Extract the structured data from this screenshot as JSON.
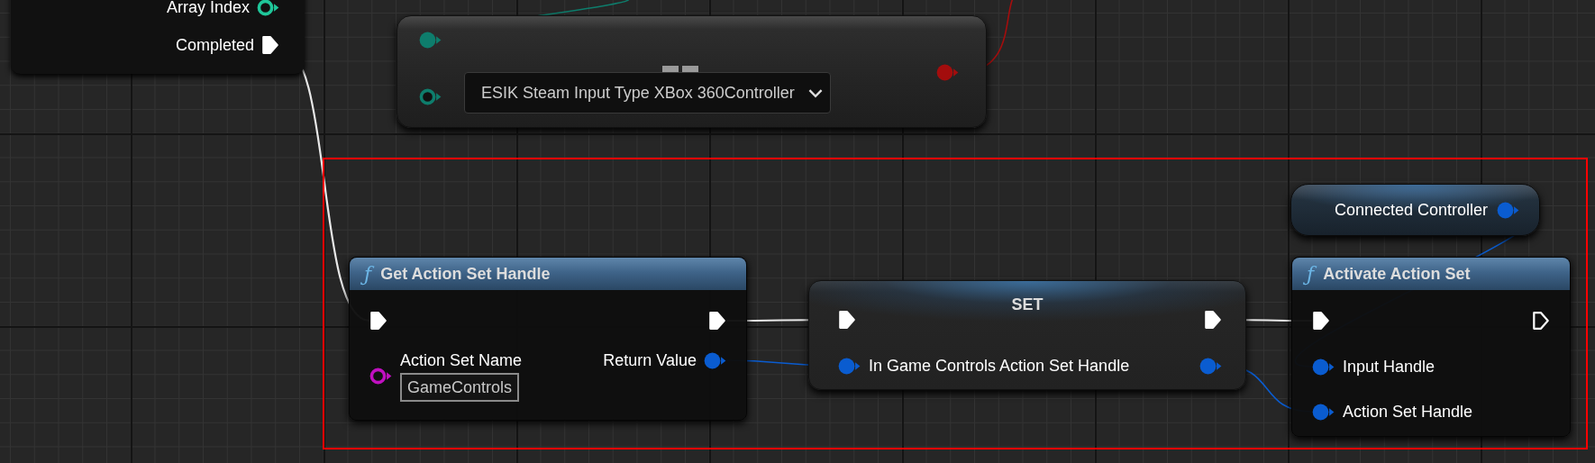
{
  "graph": {
    "highlight": {
      "color": "#ff0000"
    },
    "nodes": [
      {
        "kind": "loop",
        "outputs": [
          {
            "label": "Array Index",
            "pin": {
              "kind": "data",
              "color": "#1fc79a",
              "connected": false
            }
          },
          {
            "label": "Completed",
            "pin": {
              "kind": "exec",
              "connected": true
            }
          }
        ]
      },
      {
        "kind": "compare",
        "inputs": [
          {
            "pin": {
              "kind": "data",
              "color": "#0e7d6c",
              "connected": true
            }
          },
          {
            "pin": {
              "kind": "data",
              "color": "#0e7d6c",
              "connected": false
            },
            "dropdown": "ESIK Steam Input Type XBox 360Controller"
          }
        ],
        "output": {
          "kind": "data",
          "color": "#a30d0d",
          "connected": true
        }
      },
      {
        "kind": "function",
        "icon": "ƒ",
        "title": "Get Action Set Handle",
        "exec_in": {
          "kind": "exec",
          "connected": true
        },
        "exec_out": {
          "kind": "exec",
          "connected": true
        },
        "inputs": [
          {
            "label": "Action Set Name",
            "pin": {
              "kind": "data",
              "color": "#c010c0",
              "connected": false
            },
            "field": "GameControls"
          }
        ],
        "outputs": [
          {
            "label": "Return Value",
            "pin": {
              "kind": "data",
              "color": "#0a5cd0",
              "connected": true
            }
          }
        ]
      },
      {
        "kind": "set",
        "title": "SET",
        "exec_in": {
          "kind": "exec",
          "connected": true
        },
        "exec_out": {
          "kind": "exec",
          "connected": true
        },
        "inputs": [
          {
            "label": "In Game Controls Action Set Handle",
            "pin": {
              "kind": "data",
              "color": "#0a5cd0",
              "connected": true
            }
          }
        ],
        "outputs": [
          {
            "pin": {
              "kind": "data",
              "color": "#0a5cd0",
              "connected": true
            }
          }
        ]
      },
      {
        "kind": "variable",
        "outputs": [
          {
            "label": "Connected Controller",
            "pin": {
              "kind": "data",
              "color": "#0a5cd0",
              "connected": true
            }
          }
        ]
      },
      {
        "kind": "function",
        "icon": "ƒ",
        "title": "Activate Action Set",
        "exec_in": {
          "kind": "exec",
          "connected": true
        },
        "exec_out": {
          "kind": "exec",
          "connected": false
        },
        "inputs": [
          {
            "label": "Input Handle",
            "pin": {
              "kind": "data",
              "color": "#0a5cd0",
              "connected": true
            }
          },
          {
            "label": "Action Set Handle",
            "pin": {
              "kind": "data",
              "color": "#0a5cd0",
              "connected": true
            }
          }
        ]
      }
    ]
  }
}
